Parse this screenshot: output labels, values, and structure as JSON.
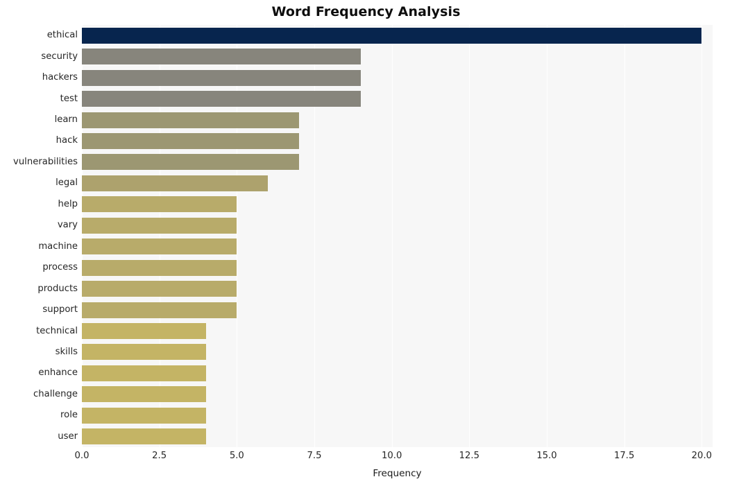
{
  "chart_data": {
    "type": "bar",
    "orientation": "horizontal",
    "title": "Word Frequency Analysis",
    "xlabel": "Frequency",
    "ylabel": "",
    "categories": [
      "ethical",
      "security",
      "hackers",
      "test",
      "learn",
      "hack",
      "vulnerabilities",
      "legal",
      "help",
      "vary",
      "machine",
      "process",
      "products",
      "support",
      "technical",
      "skills",
      "enhance",
      "challenge",
      "role",
      "user"
    ],
    "values": [
      20,
      9,
      9,
      9,
      7,
      7,
      7,
      6,
      5,
      5,
      5,
      5,
      5,
      5,
      4,
      4,
      4,
      4,
      4,
      4
    ],
    "bar_colors": [
      "#07254e",
      "#87857c",
      "#87857c",
      "#87857c",
      "#9c9772",
      "#9c9772",
      "#9c9772",
      "#ada26d",
      "#b8ab6a",
      "#b8ab6a",
      "#b8ab6a",
      "#b8ab6a",
      "#b8ab6a",
      "#b8ab6a",
      "#c4b465",
      "#c4b465",
      "#c4b465",
      "#c4b465",
      "#c4b465",
      "#c4b465"
    ],
    "xlim": [
      0.0,
      20.35
    ],
    "xticks": [
      0.0,
      2.5,
      5.0,
      7.5,
      10.0,
      12.5,
      15.0,
      17.5,
      20.0
    ],
    "xtick_labels": [
      "0.0",
      "2.5",
      "5.0",
      "7.5",
      "10.0",
      "12.5",
      "15.0",
      "17.5",
      "20.0"
    ],
    "grid": "vertical-only",
    "legend": "none",
    "plot_background": "#f7f7f7",
    "gridline_color": "#ffffff",
    "figure_background": "#ffffff"
  }
}
